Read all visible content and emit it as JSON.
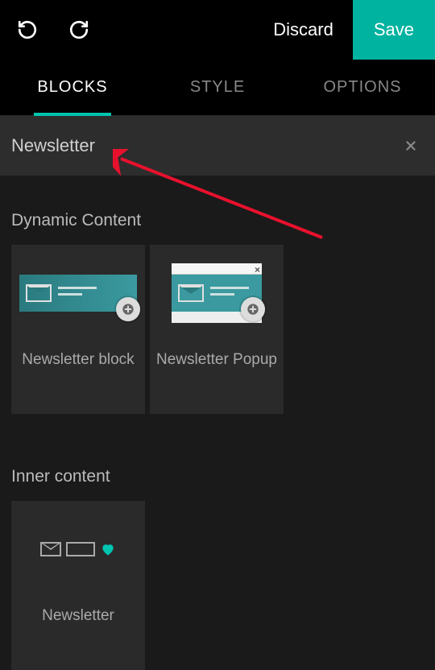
{
  "toolbar": {
    "discard_label": "Discard",
    "save_label": "Save"
  },
  "tabs": {
    "blocks": "BLOCKS",
    "style": "STYLE",
    "options": "OPTIONS",
    "active": "blocks"
  },
  "search": {
    "value": "Newsletter"
  },
  "sections": [
    {
      "title": "Dynamic Content",
      "items": [
        {
          "label": "Newsletter block",
          "thumb": "newsletter-block"
        },
        {
          "label": "Newsletter Popup",
          "thumb": "newsletter-popup"
        }
      ]
    },
    {
      "title": "Inner content",
      "items": [
        {
          "label": "Newsletter",
          "thumb": "newsletter-inner"
        }
      ]
    }
  ],
  "colors": {
    "accent": "#00c4b0",
    "save_bg": "#00b3a0"
  }
}
